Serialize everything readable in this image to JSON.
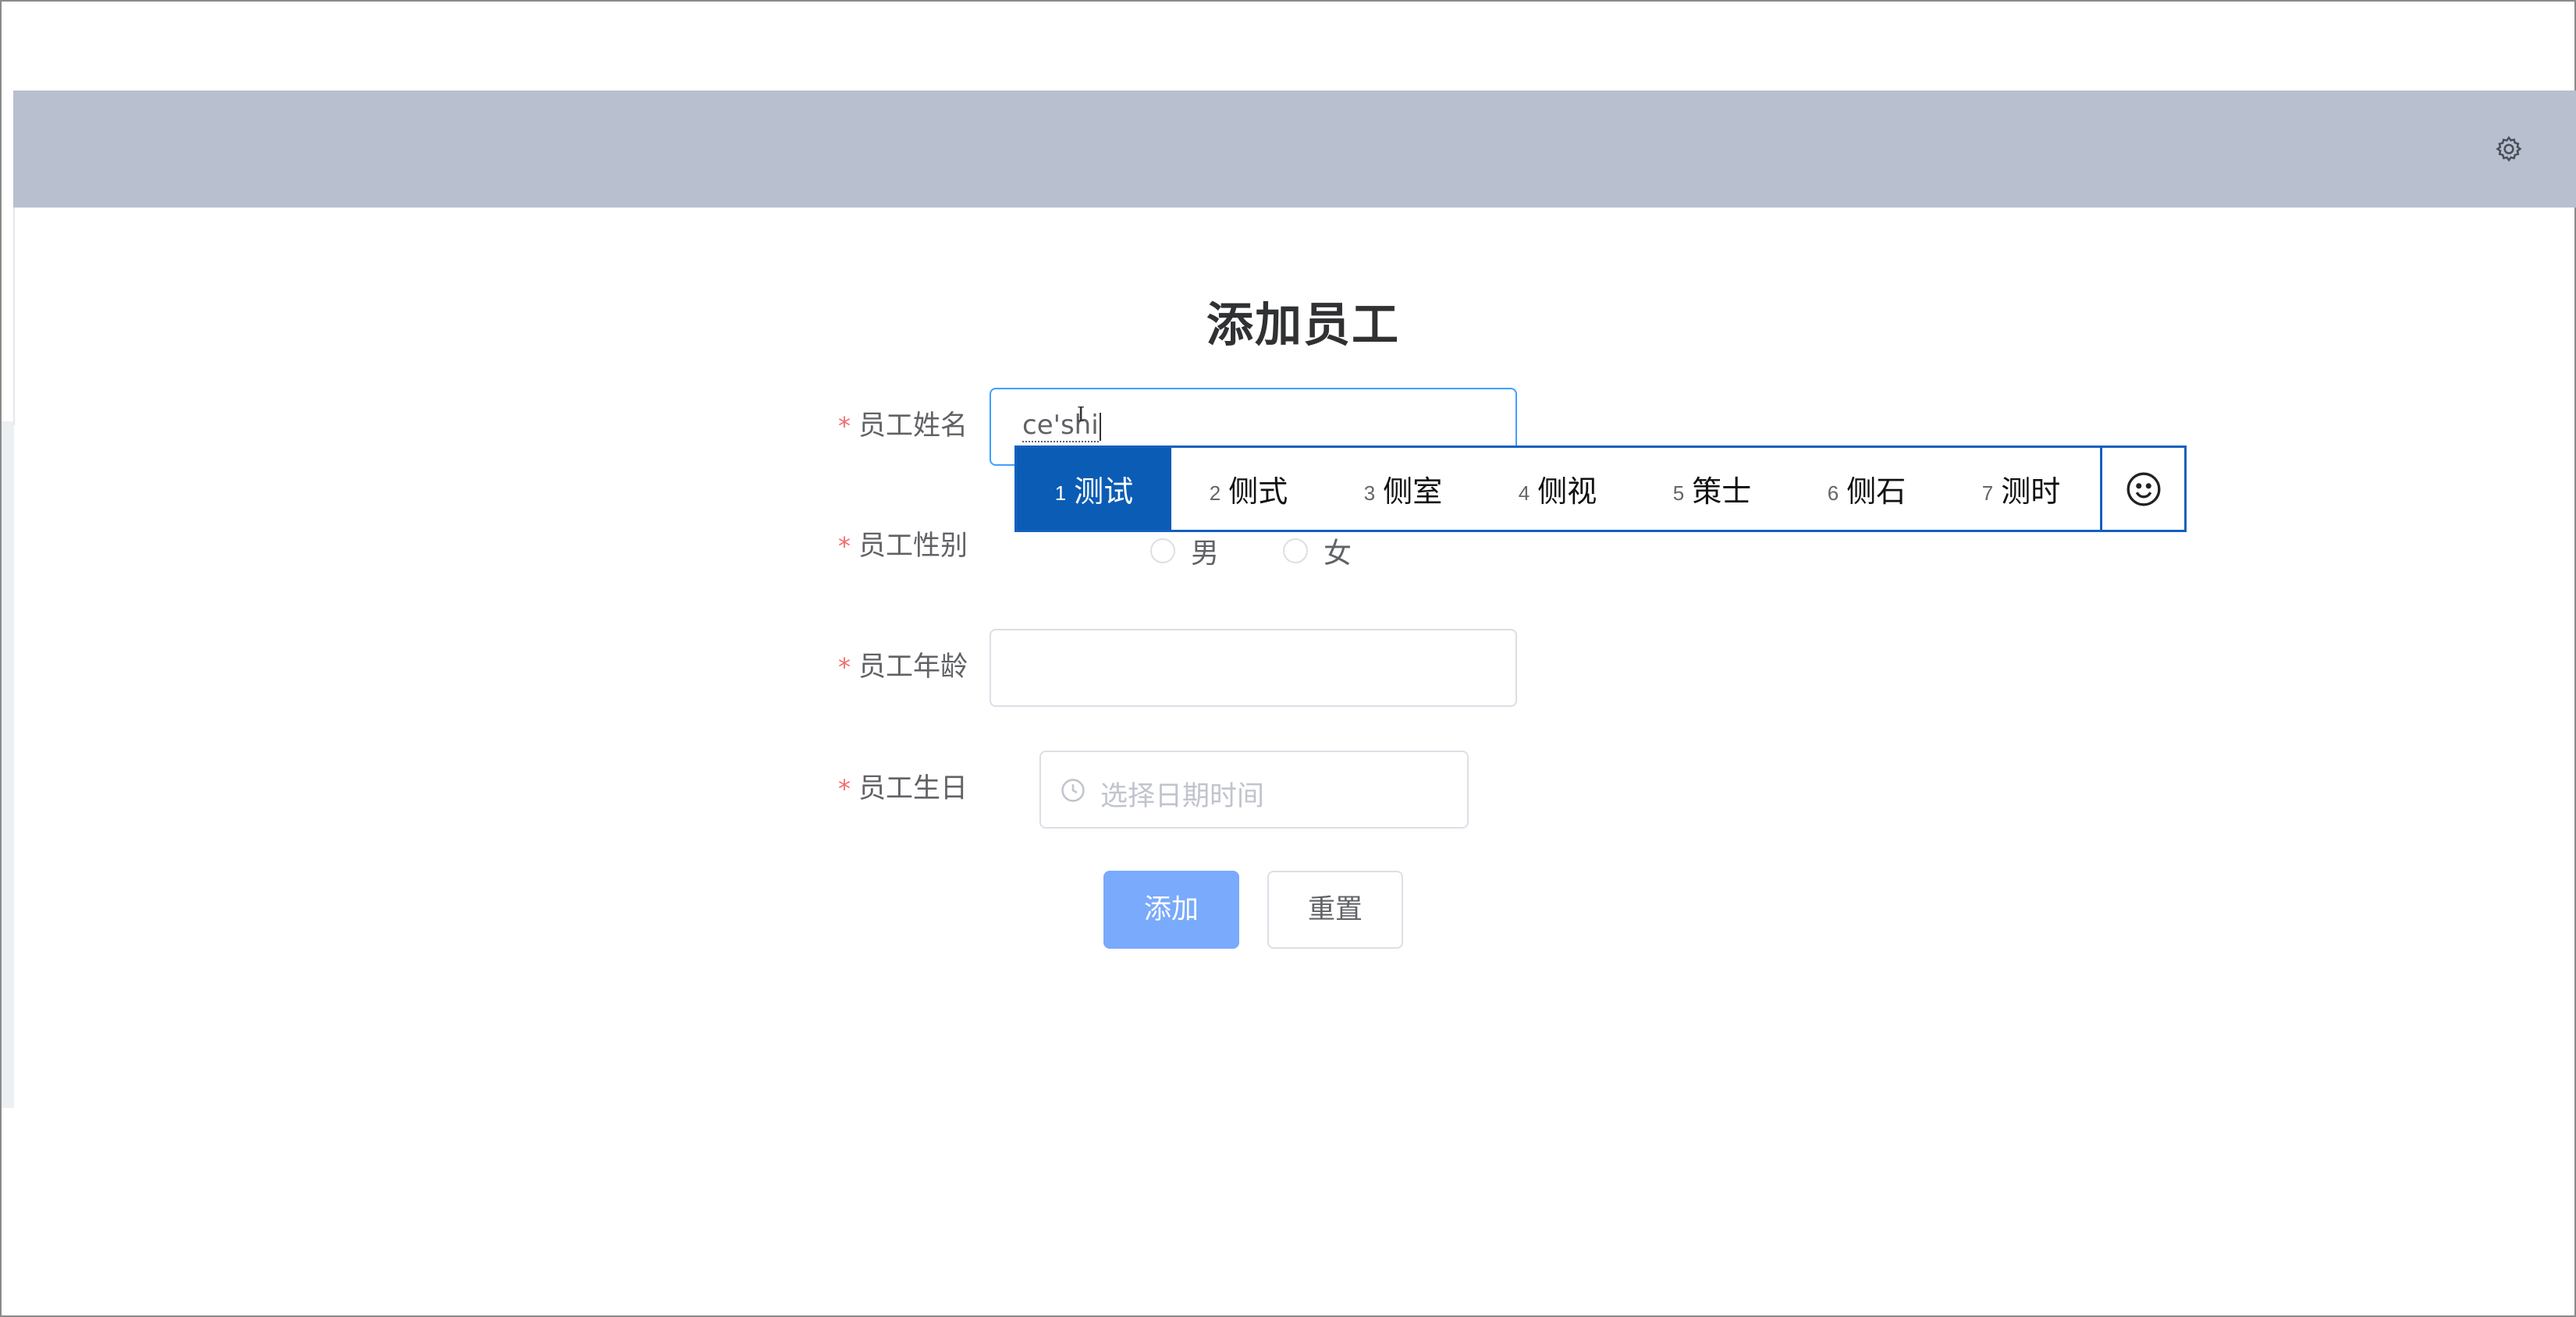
{
  "header": {
    "settings_icon": "gear-icon"
  },
  "page": {
    "title": "添加员工"
  },
  "form": {
    "required_mark": "*",
    "name": {
      "label": "员工姓名",
      "composition": "ce'sh",
      "value_tail": "i"
    },
    "gender": {
      "label": "员工性别",
      "options": [
        "男",
        "女"
      ],
      "selected": null
    },
    "age": {
      "label": "员工年龄",
      "value": ""
    },
    "birthday": {
      "label": "员工生日",
      "placeholder": "选择日期时间",
      "icon": "clock-icon"
    }
  },
  "buttons": {
    "add": "添加",
    "reset": "重置"
  },
  "ime": {
    "candidates": [
      {
        "num": "1",
        "text": "测试"
      },
      {
        "num": "2",
        "text": "侧式"
      },
      {
        "num": "3",
        "text": "侧室"
      },
      {
        "num": "4",
        "text": "侧视"
      },
      {
        "num": "5",
        "text": "策士"
      },
      {
        "num": "6",
        "text": "侧石"
      },
      {
        "num": "7",
        "text": "测时"
      }
    ],
    "selected_index": 0,
    "emoji_icon": "smiley-icon"
  },
  "colors": {
    "header_bg": "#b8c0cf",
    "primary_button": "#79aafc",
    "focus_border": "#409eff",
    "required": "#f56c6c",
    "ime_border": "#1560bd",
    "ime_selected": "#0b5cb5"
  }
}
